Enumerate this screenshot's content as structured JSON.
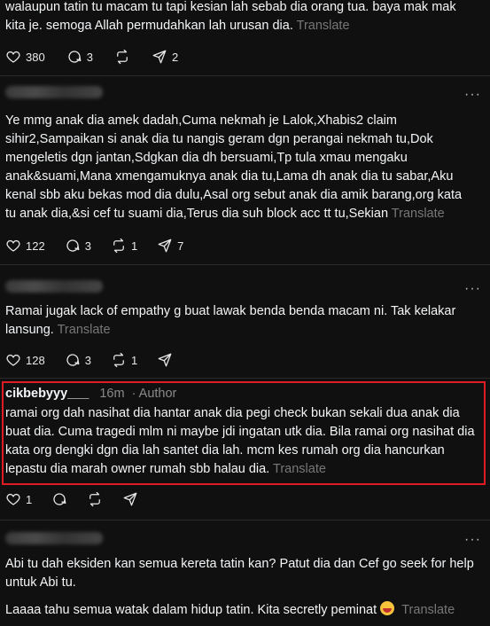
{
  "translate_label": "Translate",
  "more_label": "···",
  "posts": [
    {
      "text": "walaupun tatin tu macam tu tapi kesian lah sebab dia orang tua. baya mak mak kita je. semoga Allah permudahkan lah urusan dia.",
      "likes": "380",
      "replies": "3",
      "reposts": "",
      "shares": "2"
    },
    {
      "text": "Ye mmg anak dia amek dadah,Cuma nekmah je Lalok,Xhabis2 claim sihir2,Sampaikan si anak dia tu nangis geram dgn perangai nekmah tu,Dok mengeletis dgn jantan,Sdgkan dia dh bersuami,Tp tula xmau mengaku anak&suami,Mana xmengamuknya anak dia tu,Lama dh anak dia tu sabar,Aku kenal sbb aku bekas mod dia dulu,Asal org sebut anak dia amik barang,org kata tu anak dia,&si cef tu suami dia,Terus dia suh block acc tt tu,Sekian",
      "likes": "122",
      "replies": "3",
      "reposts": "1",
      "shares": "7"
    },
    {
      "text": "Ramai jugak lack of empathy g buat lawak benda benda macam ni. Tak kelakar lansung.",
      "likes": "128",
      "replies": "3",
      "reposts": "1",
      "shares": ""
    },
    {
      "author": "cikbebyyy___",
      "time": "16m",
      "badge": "· Author",
      "text": "ramai org dah nasihat dia hantar anak dia pegi check bukan sekali dua anak dia buat dia. Cuma tragedi mlm ni maybe jdi ingatan utk dia. Bila ramai org nasihat dia kata org dengki dgn dia lah santet dia lah. mcm kes rumah org dia hancurkan lepastu dia marah owner rumah sbb halau dia.",
      "likes": "1",
      "replies": "",
      "reposts": "",
      "shares": ""
    },
    {
      "text": "Abi tu dah eksiden kan semua kereta tatin kan? Patut dia dan Cef go seek for help untuk Abi tu.",
      "text2": "Laaaa tahu semua watak dalam hidup tatin. Kita secretly peminat"
    }
  ]
}
